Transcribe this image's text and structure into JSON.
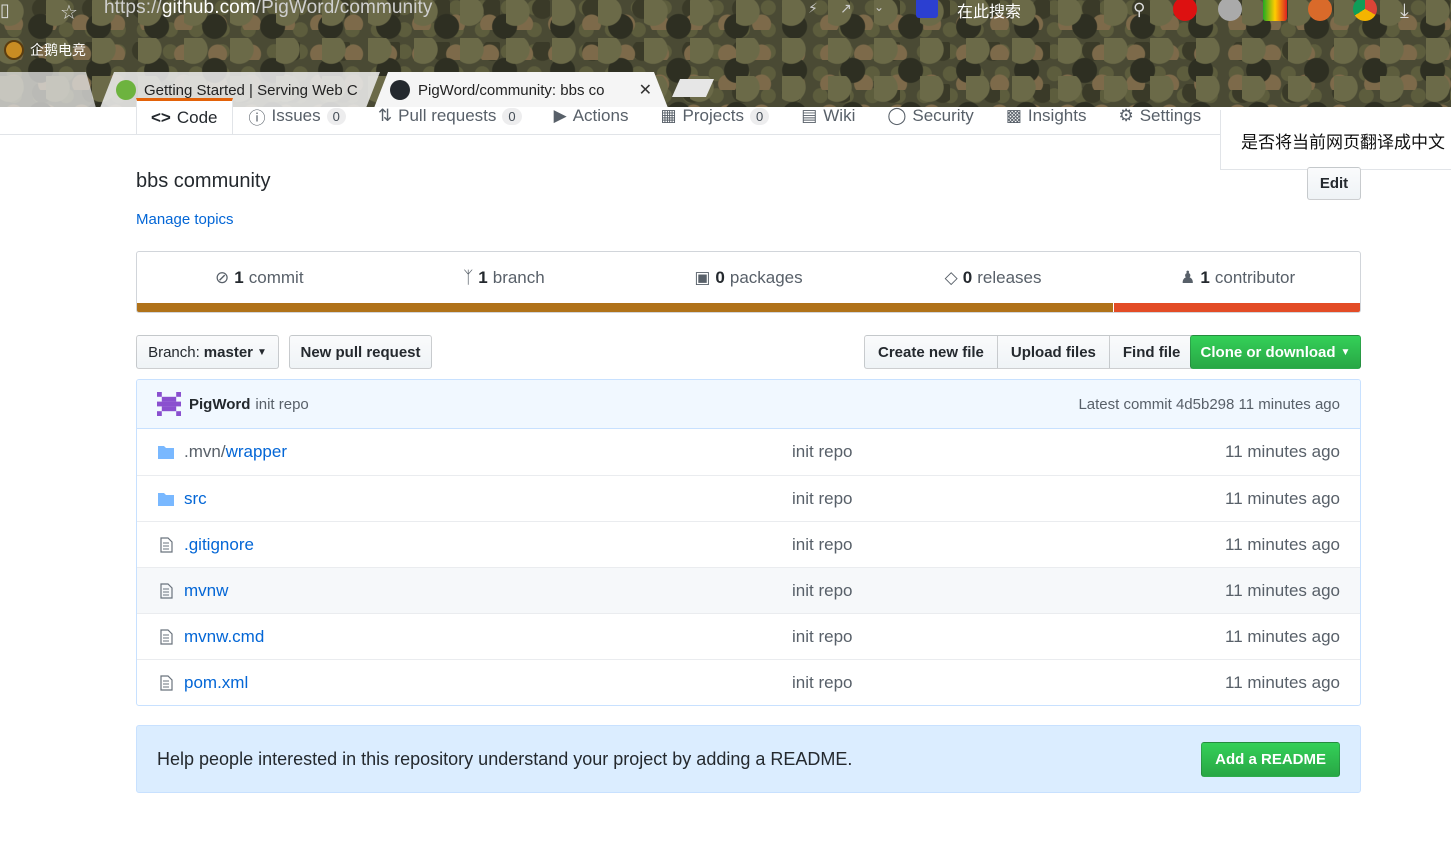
{
  "browser": {
    "url_scheme": "https://",
    "url_host": "github.com",
    "url_path": "/PigWord/community",
    "search_label": "在此搜索",
    "bookmark": "企鹅电竞",
    "tabs": [
      {
        "title": "Getting Started | Serving Web C"
      },
      {
        "title": "PigWord/community: bbs co",
        "close": "✕"
      }
    ]
  },
  "translate_prompt": "是否将当前网页翻译成中文",
  "nav": {
    "code": "Code",
    "issues": "Issues",
    "issues_count": "0",
    "pulls": "Pull requests",
    "pulls_count": "0",
    "actions": "Actions",
    "projects": "Projects",
    "projects_count": "0",
    "wiki": "Wiki",
    "security": "Security",
    "insights": "Insights",
    "settings": "Settings"
  },
  "repo": {
    "description": "bbs community",
    "manage_topics": "Manage topics",
    "edit": "Edit"
  },
  "summary": {
    "commits_num": "1",
    "commits_label": "commit",
    "branches_num": "1",
    "branches_label": "branch",
    "packages_num": "0",
    "packages_label": "packages",
    "releases_num": "0",
    "releases_label": "releases",
    "contributors_num": "1",
    "contributors_label": "contributor",
    "languages": [
      {
        "color": "#b07219",
        "percent": 79.8
      },
      {
        "color": "#e34c26",
        "percent": 20.2
      }
    ]
  },
  "toolbar": {
    "branch_prefix": "Branch:",
    "branch_name": "master",
    "new_pr": "New pull request",
    "create_file": "Create new file",
    "upload_files": "Upload files",
    "find_file": "Find file",
    "clone": "Clone or download"
  },
  "commit": {
    "author": "PigWord",
    "message": "init repo",
    "latest": "Latest commit 4d5b298 11 minutes ago"
  },
  "files": [
    {
      "name_prefix": ".mvn/",
      "name": "wrapper",
      "type": "dir",
      "message": "init repo",
      "age": "11 minutes ago"
    },
    {
      "name_prefix": "",
      "name": "src",
      "type": "dir",
      "message": "init repo",
      "age": "11 minutes ago"
    },
    {
      "name_prefix": "",
      "name": ".gitignore",
      "type": "file",
      "message": "init repo",
      "age": "11 minutes ago"
    },
    {
      "name_prefix": "",
      "name": "mvnw",
      "type": "file",
      "message": "init repo",
      "age": "11 minutes ago"
    },
    {
      "name_prefix": "",
      "name": "mvnw.cmd",
      "type": "file",
      "message": "init repo",
      "age": "11 minutes ago"
    },
    {
      "name_prefix": "",
      "name": "pom.xml",
      "type": "file",
      "message": "init repo",
      "age": "11 minutes ago"
    }
  ],
  "readme_banner": {
    "text": "Help people interested in this repository understand your project by adding a README.",
    "button": "Add a README"
  }
}
